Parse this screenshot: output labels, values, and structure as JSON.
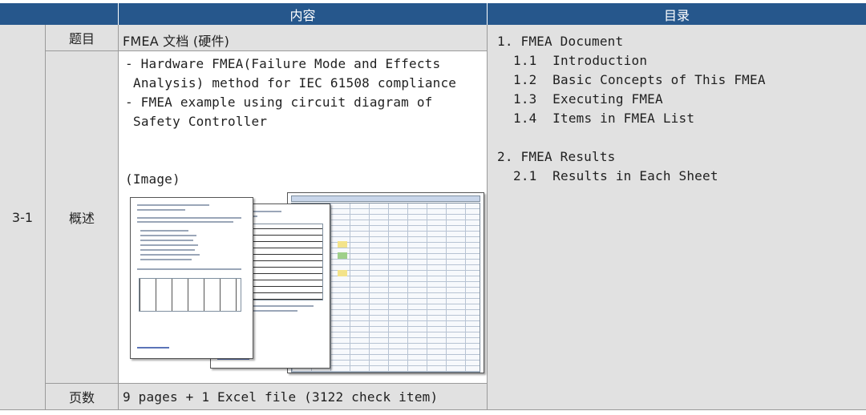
{
  "header": {
    "content_label": "内容",
    "toc_label": "目录"
  },
  "row": {
    "id": "3-1",
    "title_label": "题目",
    "title_value": "FMEA 文档 (硬件)",
    "summary_label": "概述",
    "summary_lines": [
      "- Hardware FMEA(Failure Mode and Effects",
      "Analysis) method for IEC 61508 compliance",
      "- FMEA example using circuit diagram of",
      "Safety Controller"
    ],
    "image_caption": "(Image)",
    "pages_label": "页数",
    "pages_value": "9 pages + 1 Excel file (3122 check item)"
  },
  "toc": {
    "sections": [
      {
        "title": "1. FMEA Document",
        "items": [
          "1.1  Introduction",
          "1.2  Basic Concepts of This FMEA",
          "1.3  Executing FMEA",
          "1.4  Items in FMEA List"
        ]
      },
      {
        "title": "2. FMEA Results",
        "items": [
          "2.1  Results in Each Sheet"
        ]
      }
    ]
  },
  "colors": {
    "header_bg": "#26578c",
    "cell_gray": "#e1e1e1",
    "cell_white": "#ffffff"
  }
}
